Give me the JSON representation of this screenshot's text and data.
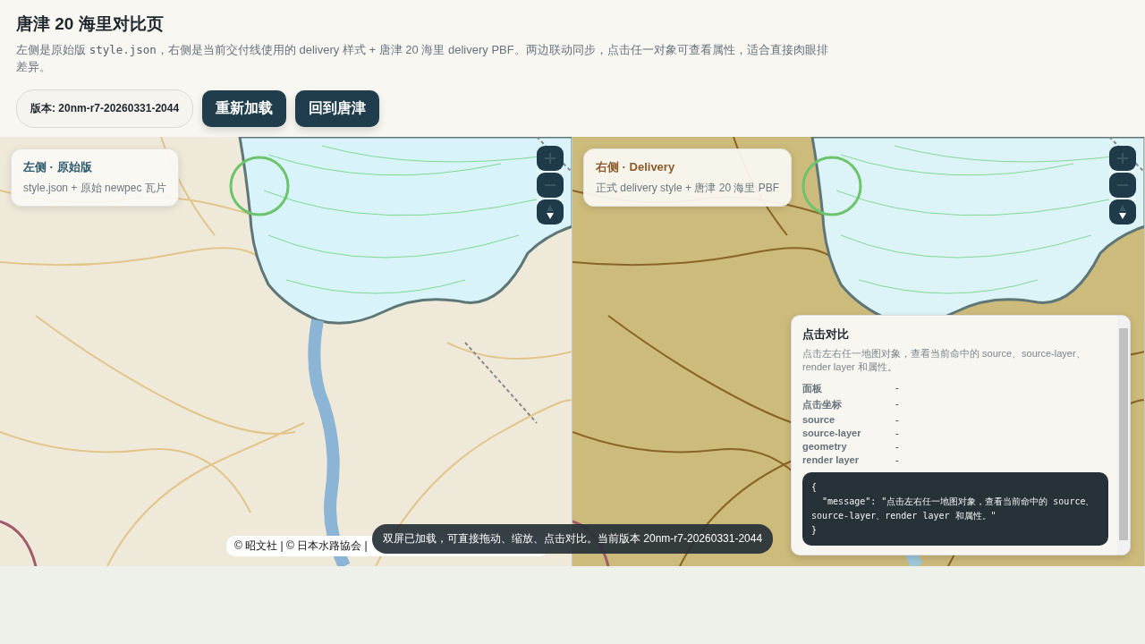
{
  "header": {
    "title": "唐津 20 海里对比页",
    "description": [
      {
        "kind": "text",
        "text": "左侧是原始版 "
      },
      {
        "kind": "code",
        "text": "style.json"
      },
      {
        "kind": "text",
        "text": "，右侧是当前交付线使用的 delivery 样式 + 唐津 20 海里 delivery PBF。两边联动同步，点击任一对象可查看属性，适合直接肉眼排差异。"
      }
    ],
    "version_badge": "版本: 20nm-r7-20260331-2044",
    "buttons": [
      "重新加载",
      "回到唐津"
    ]
  },
  "maps": [
    {
      "kind": "original",
      "label_title": "左侧 · 原始版",
      "label_subtitle": "style.json + 原始 newpec 瓦片",
      "attribution": "© 昭文社 | © 日本水路協会 |"
    },
    {
      "kind": "delivery",
      "label_title": "右侧 · Delivery",
      "label_subtitle": "正式 delivery style + 唐津 20 海里 PBF"
    }
  ],
  "inspector": {
    "title": "点击对比",
    "hint": "点击左右任一地图对象，查看当前命中的 source、source-layer、render layer 和属性。",
    "fields": [
      {
        "label": "面板",
        "value": "-"
      },
      {
        "label": "点击坐标",
        "value": "-"
      },
      {
        "label": "source",
        "value": "-"
      },
      {
        "label": "source-layer",
        "value": "-"
      },
      {
        "label": "geometry",
        "value": "-"
      },
      {
        "label": "render layer",
        "value": "-"
      }
    ],
    "code": "{\n  \"message\": \"点击左右任一地图对象，查看当前命中的 source、source-layer、render layer 和属性。\"\n}"
  },
  "toast": "双屏已加载，可直接拖动、缩放、点击对比。当前版本 20nm-r7-20260331-2044"
}
